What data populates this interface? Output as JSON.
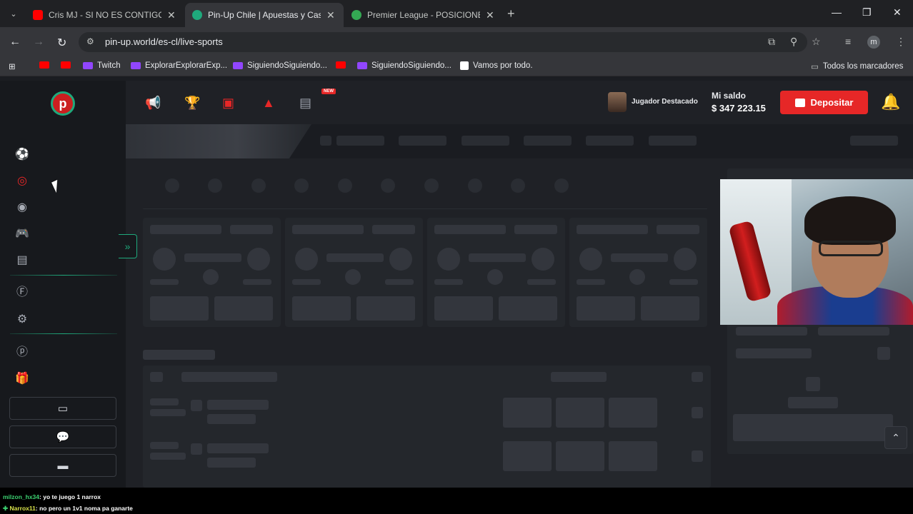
{
  "browser": {
    "tabs": [
      {
        "title": "Cris MJ - SI NO ES CONTIGO (V",
        "favicon_color": "#ff0000",
        "active": false
      },
      {
        "title": "Pin-Up Chile | Apuestas y Casin",
        "favicon_color": "#1fa97c",
        "active": true
      },
      {
        "title": "Premier League - POSICIONES,",
        "favicon_color": "#34a853",
        "active": false
      }
    ],
    "new_tab_symbol": "+",
    "close_symbol": "✕",
    "url": "pin-up.world/es-cl/live-sports",
    "profile_initial": "m",
    "bookmarks": [
      {
        "label": "",
        "type": "youtube"
      },
      {
        "label": "",
        "type": "youtube"
      },
      {
        "label": "Twitch",
        "type": "twitch"
      },
      {
        "label": "ExplorarExplorarExp...",
        "type": "twitch"
      },
      {
        "label": "SiguiendoSiguiendo...",
        "type": "twitch"
      },
      {
        "label": "",
        "type": "youtube"
      },
      {
        "label": "SiguiendoSiguiendo...",
        "type": "twitch"
      },
      {
        "label": "Vamos por todo.",
        "type": "x"
      }
    ],
    "all_bookmarks_label": "Todos los marcadores"
  },
  "site": {
    "logo_letter": "p",
    "new_badge": "NEW",
    "featured_player_label": "Jugador Destacado",
    "balance_label": "Mi saldo",
    "balance_value": "$ 347 223.15",
    "deposit_label": "Depositar",
    "accent_color": "#1fa97c",
    "brand_red": "#e62727"
  },
  "chat": [
    {
      "user": "milzon_hx34",
      "message": ": yo te juego 1 narrox"
    },
    {
      "user": "Narrox11",
      "message": ": no pero un 1v1 noma pa ganarte"
    }
  ]
}
